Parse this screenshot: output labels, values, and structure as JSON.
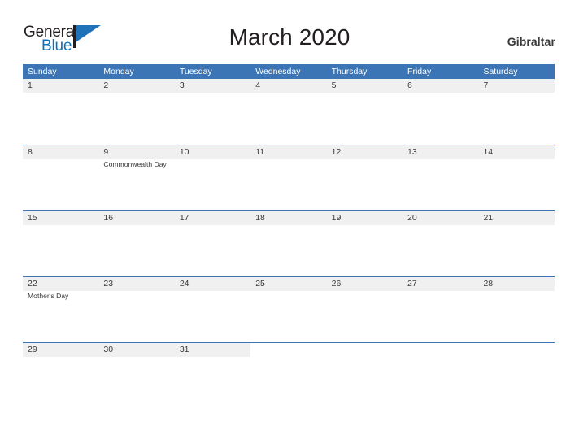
{
  "brand": {
    "name_part1": "General",
    "name_part2": "Blue",
    "flag_icon": "flag-icon",
    "color_dark": "#231f20",
    "color_blue": "#0b72b9"
  },
  "header": {
    "title": "March 2020",
    "location": "Gibraltar"
  },
  "colors": {
    "header_blue": "#3b75b5",
    "band_gray": "#f0f0f0",
    "text_gray": "#3a3a3a",
    "background": "#ffffff"
  },
  "calendar": {
    "month": "March",
    "year": "2020",
    "weekdays": [
      "Sunday",
      "Monday",
      "Tuesday",
      "Wednesday",
      "Thursday",
      "Friday",
      "Saturday"
    ],
    "weeks": [
      [
        {
          "day": "1",
          "events": []
        },
        {
          "day": "2",
          "events": []
        },
        {
          "day": "3",
          "events": []
        },
        {
          "day": "4",
          "events": []
        },
        {
          "day": "5",
          "events": []
        },
        {
          "day": "6",
          "events": []
        },
        {
          "day": "7",
          "events": []
        }
      ],
      [
        {
          "day": "8",
          "events": []
        },
        {
          "day": "9",
          "events": [
            "Commonwealth Day"
          ]
        },
        {
          "day": "10",
          "events": []
        },
        {
          "day": "11",
          "events": []
        },
        {
          "day": "12",
          "events": []
        },
        {
          "day": "13",
          "events": []
        },
        {
          "day": "14",
          "events": []
        }
      ],
      [
        {
          "day": "15",
          "events": []
        },
        {
          "day": "16",
          "events": []
        },
        {
          "day": "17",
          "events": []
        },
        {
          "day": "18",
          "events": []
        },
        {
          "day": "19",
          "events": []
        },
        {
          "day": "20",
          "events": []
        },
        {
          "day": "21",
          "events": []
        }
      ],
      [
        {
          "day": "22",
          "events": [
            "Mother's Day"
          ]
        },
        {
          "day": "23",
          "events": []
        },
        {
          "day": "24",
          "events": []
        },
        {
          "day": "25",
          "events": []
        },
        {
          "day": "26",
          "events": []
        },
        {
          "day": "27",
          "events": []
        },
        {
          "day": "28",
          "events": []
        }
      ],
      [
        {
          "day": "29",
          "events": []
        },
        {
          "day": "30",
          "events": []
        },
        {
          "day": "31",
          "events": []
        },
        {
          "day": "",
          "events": []
        },
        {
          "day": "",
          "events": []
        },
        {
          "day": "",
          "events": []
        },
        {
          "day": "",
          "events": []
        }
      ]
    ]
  }
}
